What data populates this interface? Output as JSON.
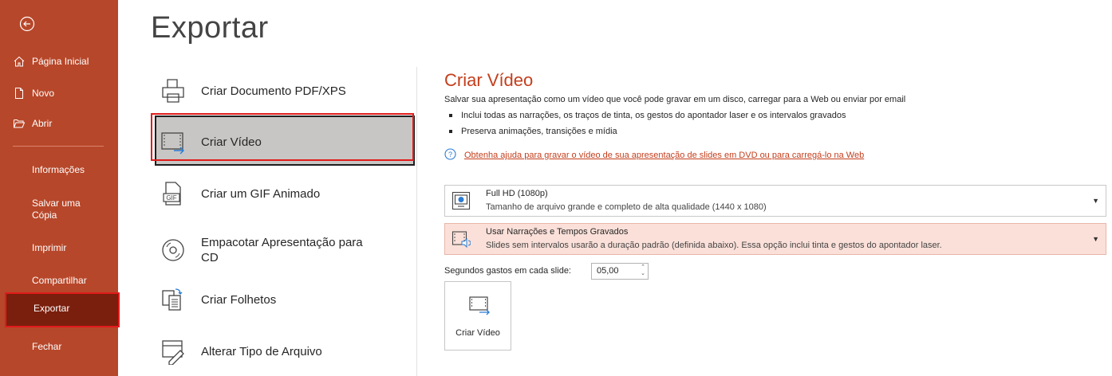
{
  "page_title": "Exportar",
  "sidebar": {
    "items": [
      {
        "label": "Página Inicial",
        "icon": "home-icon"
      },
      {
        "label": "Novo",
        "icon": "new-file-icon"
      },
      {
        "label": "Abrir",
        "icon": "open-folder-icon"
      }
    ],
    "sub": {
      "informacoes": "Informações",
      "salvar_line1": "Salvar uma",
      "salvar_line2": "Cópia",
      "imprimir": "Imprimir",
      "compartilhar": "Compartilhar",
      "exportar": "Exportar",
      "fechar": "Fechar"
    }
  },
  "options": {
    "pdf": "Criar Documento PDF/XPS",
    "video": "Criar Vídeo",
    "gif": "Criar um GIF Animado",
    "cd_line1": "Empacotar Apresentação para",
    "cd_line2": "CD",
    "folhetos": "Criar Folhetos",
    "tipo": "Alterar Tipo de Arquivo"
  },
  "panel": {
    "title": "Criar Vídeo",
    "description": "Salvar sua apresentação como um vídeo que você pode gravar em um disco, carregar para a Web ou enviar por email",
    "bullets": [
      "Inclui todas as narrações, os traços de tinta, os gestos do apontador laser e os intervalos gravados",
      "Preserva animações, transições e mídia"
    ],
    "help_link": "Obtenha ajuda para gravar o vídeo de sua apresentação de slides em DVD ou para carregá-lo na Web",
    "quality": {
      "line1": "Full HD (1080p)",
      "line2": "Tamanho de arquivo grande e completo de alta qualidade (1440 x 1080)"
    },
    "narration": {
      "line1": "Usar Narrações e Tempos Gravados",
      "line2": "Slides sem intervalos usarão a duração padrão (definida abaixo). Essa opção inclui tinta e gestos do apontador laser."
    },
    "seconds_label": "Segundos gastos em cada slide:",
    "seconds_value": "05,00",
    "create_button": "Criar Vídeo"
  },
  "colors": {
    "sidebar": "#b7472a",
    "sidebar_active": "#7a1f0d",
    "accent": "#c43e1c",
    "highlight_border": "#e01b1b"
  }
}
